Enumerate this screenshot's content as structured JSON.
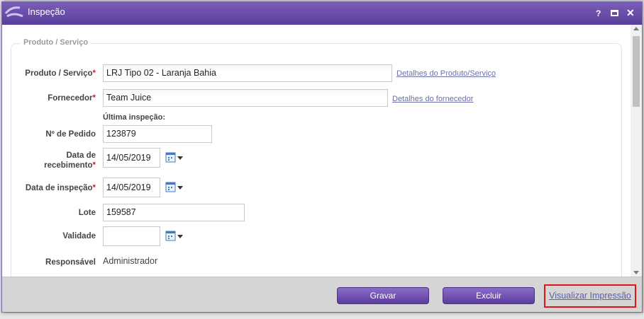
{
  "window": {
    "title": "Inspeção",
    "help": "?",
    "close": "✕"
  },
  "section": {
    "legend": "Produto / Serviço"
  },
  "form": {
    "produto": {
      "label": "Produto / Serviço",
      "required": "*",
      "value": "LRJ Tipo 02 - Laranja Bahia",
      "link": "Detalhes do Produto/Serviço"
    },
    "fornecedor": {
      "label": "Fornecedor",
      "required": "*",
      "value": "Team Juice",
      "link": "Detalhes do fornecedor"
    },
    "ultima_inspecao": {
      "label": "Última inspeção:"
    },
    "pedido": {
      "label": "Nº de Pedido",
      "value": "123879"
    },
    "recebimento": {
      "label_line1": "Data de",
      "label_line2": "recebimento",
      "required": "*",
      "value": "14/05/2019"
    },
    "inspecao": {
      "label": "Data de inspeção",
      "required": "*",
      "value": "14/05/2019"
    },
    "lote": {
      "label": "Lote",
      "value": "159587"
    },
    "validade": {
      "label": "Validade",
      "value": ""
    },
    "responsavel": {
      "label": "Responsável",
      "value": "Administrador"
    }
  },
  "footer": {
    "save_label": "Gravar",
    "delete_label": "Excluir",
    "print_label": "Visualizar Impressão"
  },
  "colors": {
    "titlebar": "#6a4fae",
    "button": "#6c4db3",
    "required": "#c62828",
    "highlight": "#e01414"
  }
}
